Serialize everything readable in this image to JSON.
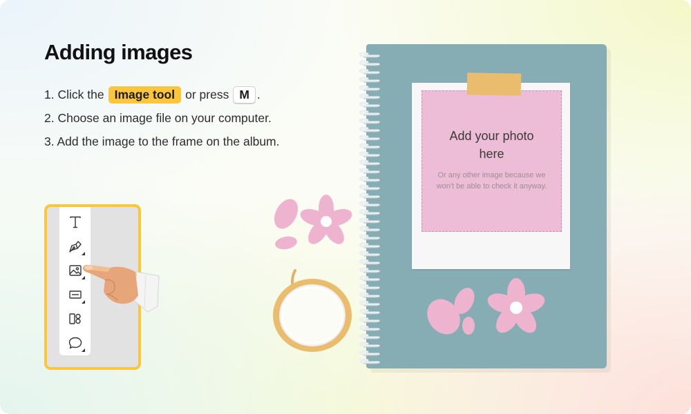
{
  "heading": "Adding images",
  "steps": {
    "s1_number": "1.",
    "s1_text_a": "Click the",
    "s1_tool_name": "Image tool",
    "s1_text_b": "or press",
    "s1_key": "M",
    "s1_end": ".",
    "s2": "2. Choose an image file on your computer.",
    "s3": "3. Add the image to the frame on the album."
  },
  "toolbar": {
    "tools": [
      {
        "icon": "text-tool-icon"
      },
      {
        "icon": "pen-tool-icon"
      },
      {
        "icon": "image-tool-icon"
      },
      {
        "icon": "shape-tool-icon"
      },
      {
        "icon": "sticker-tool-icon"
      },
      {
        "icon": "comment-tool-icon"
      }
    ]
  },
  "album": {
    "photo_title": "Add your photo here",
    "photo_subtitle": "Or any other image because we won't be able to check it anyway."
  },
  "colors": {
    "highlight": "#fcc63c",
    "notebook": "#87adb4",
    "photo_slot": "#edbcd6",
    "flower": "#eeb4cf",
    "tape": "#e9bd6d"
  }
}
